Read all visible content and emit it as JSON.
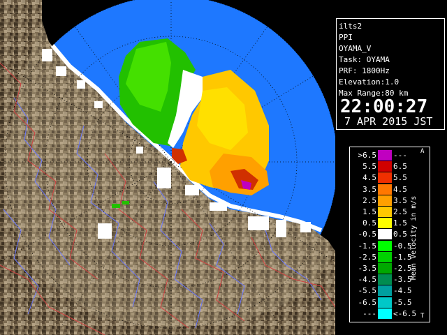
{
  "info": {
    "lines": [
      "ilts2",
      "PPI",
      "OYAMA_V",
      "Task: OYAMA",
      "PRF: 1800Hz",
      "Elevation:1.0",
      "Max Range:80 km"
    ],
    "time": "22:00:27",
    "date": "7 APR 2015 JST"
  },
  "legend": {
    "title": "Mean Velocity in m/s",
    "top_mark": "A",
    "bottom_mark": "T",
    "rows": [
      {
        "left": ">6.5",
        "right": "---",
        "color": "#c000c0"
      },
      {
        "left": "5.5",
        "right": "6.5",
        "color": "#d00000"
      },
      {
        "left": "4.5",
        "right": "5.5",
        "color": "#f03000"
      },
      {
        "left": "3.5",
        "right": "4.5",
        "color": "#ff7800"
      },
      {
        "left": "2.5",
        "right": "3.5",
        "color": "#ffa000"
      },
      {
        "left": "1.5",
        "right": "2.5",
        "color": "#ffc800"
      },
      {
        "left": "0.5",
        "right": "1.5",
        "color": "#ffff00"
      },
      {
        "left": "-0.5",
        "right": "0.5",
        "color": "#ffffff"
      },
      {
        "left": "-1.5",
        "right": "-0.5",
        "color": "#00ff00"
      },
      {
        "left": "-2.5",
        "right": "-1.5",
        "color": "#00d000"
      },
      {
        "left": "-3.5",
        "right": "-2.5",
        "color": "#00a800"
      },
      {
        "left": "-4.5",
        "right": "-3.5",
        "color": "#008c50"
      },
      {
        "left": "-5.5",
        "right": "-4.5",
        "color": "#00a0a0"
      },
      {
        "left": "-6.5",
        "right": "-5.5",
        "color": "#00c8c8"
      },
      {
        "left": "---",
        "right": "<-6.5",
        "color": "#00ffff"
      }
    ]
  },
  "colors": {
    "sea": "#0050f0",
    "coverage": "#1e78ff",
    "land": "#8a7a62"
  }
}
